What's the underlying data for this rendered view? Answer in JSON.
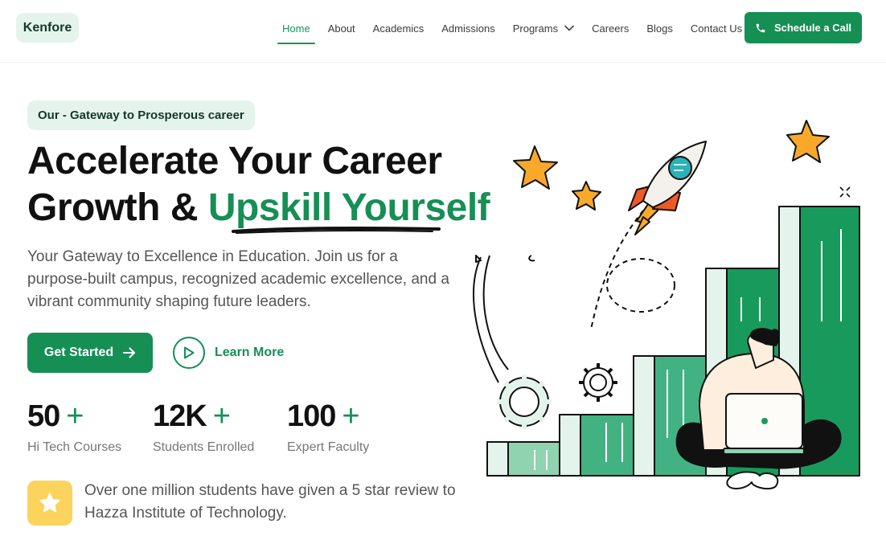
{
  "header": {
    "logo": "Kenfore",
    "nav": [
      {
        "label": "Home",
        "active": true
      },
      {
        "label": "About"
      },
      {
        "label": "Academics"
      },
      {
        "label": "Admissions"
      },
      {
        "label": "Programs",
        "dropdown": true
      },
      {
        "label": "Careers"
      },
      {
        "label": "Blogs"
      },
      {
        "label": "Contact Us"
      }
    ],
    "cta_label": "Schedule a Call"
  },
  "hero": {
    "tagline": "Our - Gateway to Prosperous career",
    "headline_line1": "Accelerate Your Career",
    "headline_line2_prefix": "Growth & ",
    "headline_line2_accent": "Upskill Yourself",
    "subtext": "Your Gateway to Excellence in Education. Join us for a purpose-built campus, recognized academic excellence, and a vibrant community shaping future leaders.",
    "primary_button": "Get Started",
    "secondary_button": "Learn More"
  },
  "stats": [
    {
      "value": "50",
      "suffix": "+",
      "label": "Hi Tech Courses"
    },
    {
      "value": "12K",
      "suffix": "+",
      "label": "Students Enrolled"
    },
    {
      "value": "100",
      "suffix": "+",
      "label": "Expert Faculty"
    }
  ],
  "review": {
    "icon": "star-icon",
    "text": "Over one million students have given a 5 star review to Hazza Institute of Technology."
  },
  "colors": {
    "brand_green": "#168f55",
    "pill_bg": "#e4f4ec",
    "star_yellow": "#fcd35d"
  }
}
